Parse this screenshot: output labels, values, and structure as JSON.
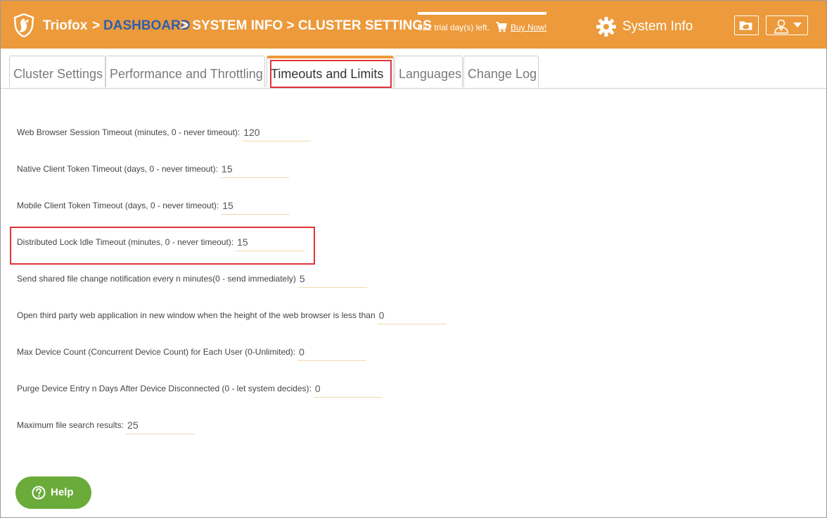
{
  "header": {
    "brand": "Triofox",
    "breadcrumb_sep": ">",
    "breadcrumb_dashboard": "DASHBOARD",
    "breadcrumb_rest": "> SYSTEM INFO > CLUSTER SETTINGS",
    "trial_text": "622 trial day(s) left.",
    "buy_now": "Buy Now!",
    "system_info": "System Info",
    "colors": {
      "header_bg": "#ec9a3b",
      "breadcrumb_link": "#2f5fae"
    },
    "icons": [
      "shield-logo-icon",
      "cart-icon",
      "gear-icon",
      "cloud-folder-icon",
      "user-icon",
      "caret-down-icon"
    ]
  },
  "tabs": [
    {
      "label": "Cluster Settings",
      "active": false
    },
    {
      "label": "Performance and Throttling",
      "active": false
    },
    {
      "label": "Timeouts and Limits",
      "active": true
    },
    {
      "label": "Languages",
      "active": false
    },
    {
      "label": "Change Log",
      "active": false
    }
  ],
  "form": {
    "fields": [
      {
        "label": "Web Browser Session Timeout (minutes, 0 - never timeout):",
        "value": "120"
      },
      {
        "label": "Native Client Token Timeout (days, 0 - never timeout):",
        "value": "15"
      },
      {
        "label": "Mobile Client Token Timeout (days, 0 - never timeout):",
        "value": "15"
      },
      {
        "label": "Distributed Lock Idle Timeout (minutes, 0 - never timeout):",
        "value": "15"
      },
      {
        "label": "Send shared file change notification every n minutes(0 - send immediately)",
        "value": "5"
      },
      {
        "label": "Open third party web application in new window when the height of the web browser is less than",
        "value": "0"
      },
      {
        "label": "Max Device Count (Concurrent Device Count) for Each User (0-Unlimited):",
        "value": "0"
      },
      {
        "label": "Purge Device Entry n Days After Device Disconnected (0 - let system decides):",
        "value": "0"
      },
      {
        "label": "Maximum file search results:",
        "value": "25"
      }
    ]
  },
  "help": {
    "label": "Help",
    "color": "#6aab3a"
  },
  "highlight_color": "#e0343b"
}
